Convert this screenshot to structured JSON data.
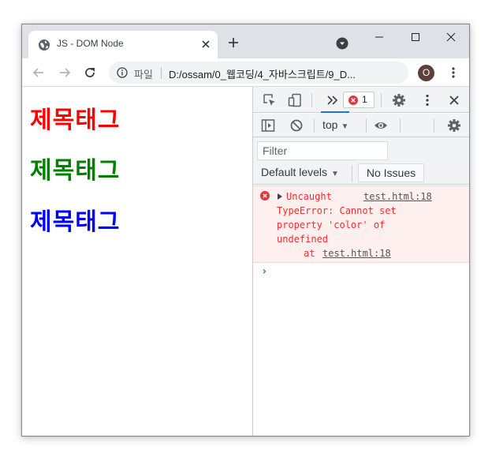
{
  "browser": {
    "tab": {
      "title": "JS - DOM Node",
      "icon": "globe-icon"
    },
    "address": {
      "scheme_label": "파일",
      "url": "D:/ossam/0_웹코딩/4_자바스크립트/9_D..."
    },
    "profile_initial": "O"
  },
  "page": {
    "headings": [
      {
        "text": "제목태그",
        "color": "#ff0000"
      },
      {
        "text": "제목태그",
        "color": "#008000"
      },
      {
        "text": "제목태그",
        "color": "#0000ff"
      }
    ]
  },
  "devtools": {
    "error_count": "1",
    "context": "top",
    "filter_placeholder": "Filter",
    "levels_label": "Default levels",
    "issues_label": "No Issues",
    "error": {
      "line1": "Uncaught",
      "source": "test.html:18",
      "line2": "TypeError: Cannot set",
      "line3": "property 'color' of",
      "line4": "undefined",
      "at_label": "at",
      "at_link": "test.html:18"
    },
    "prompt": "›"
  },
  "colors": {
    "error_text": "#fe2c2c",
    "error_bg": "#fff0f0",
    "accent": "#1a73e8"
  }
}
